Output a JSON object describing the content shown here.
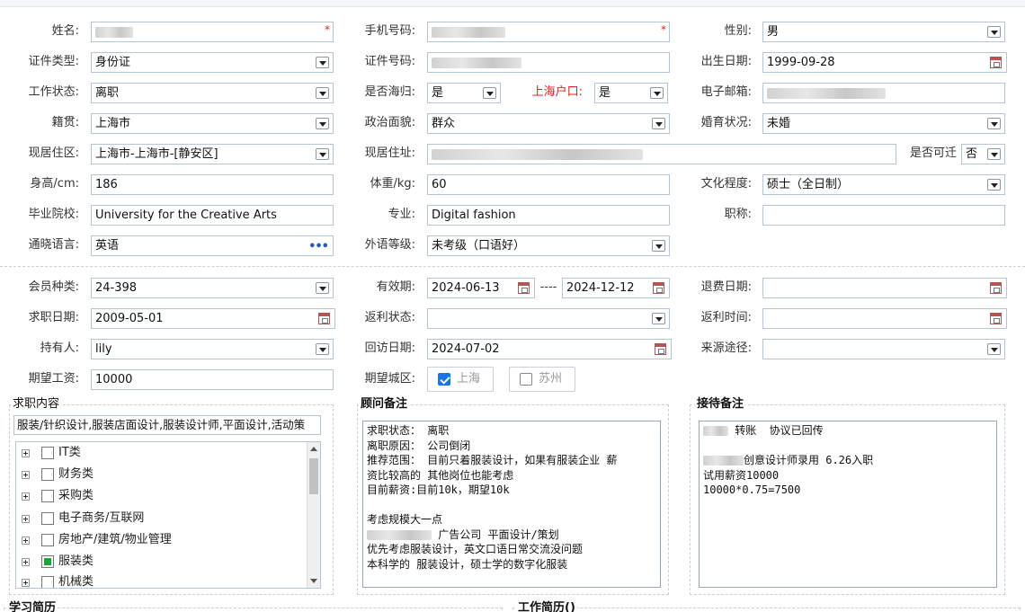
{
  "row1": {
    "name_label": "姓名:",
    "phone_label": "手机号码:",
    "gender_label": "性别:",
    "gender_value": "男",
    "required_mark": "*"
  },
  "row2": {
    "idtype_label": "证件类型:",
    "idtype_value": "身份证",
    "idno_label": "证件号码:",
    "birth_label": "出生日期:",
    "birth_value": "1999-09-28"
  },
  "row3": {
    "work_label": "工作状态:",
    "work_value": "离职",
    "returnee_label": "是否海归:",
    "returnee_value": "是",
    "hukou_label": "上海户口:",
    "hukou_value": "是",
    "email_label": "电子邮箱:"
  },
  "row4": {
    "native_label": "籍贯:",
    "native_value": "上海市",
    "political_label": "政治面貌:",
    "political_value": "群众",
    "marital_label": "婚育状况:",
    "marital_value": "未婚"
  },
  "row5": {
    "residence_label": "现居住区:",
    "residence_value": "上海市-上海市-[静安区]",
    "address_label": "现居住址:",
    "rent_label": "是否可迁",
    "rent_value": "否"
  },
  "row6": {
    "height_label": "身高/cm:",
    "height_value": "186",
    "weight_label": "体重/kg:",
    "weight_value": "60",
    "edu_label": "文化程度:",
    "edu_value": "硕士（全日制）"
  },
  "row7": {
    "school_label": "毕业院校:",
    "school_value": "University for the Creative Arts",
    "major_label": "专业:",
    "major_value": "Digital fashion",
    "title_label": "职称:"
  },
  "row8": {
    "lang_label": "通晓语言:",
    "lang_value": "英语",
    "lang_more": "•••",
    "level_label": "外语等级:",
    "level_value": "未考级（口语好）"
  },
  "row9": {
    "member_label": "会员种类:",
    "member_value": "24-398",
    "valid_label": "有效期:",
    "valid_from": "2024-06-13",
    "valid_sep": "----",
    "valid_to": "2024-12-12",
    "refund_label": "退费日期:"
  },
  "row10": {
    "apply_label": "求职日期:",
    "apply_value": "2009-05-01",
    "rebate_label": "返利状态:",
    "rebate_time_label": "返利时间:"
  },
  "row11": {
    "holder_label": "持有人:",
    "holder_value": "lily",
    "visit_label": "回访日期:",
    "visit_value": "2024-07-02",
    "source_label": "来源途径:"
  },
  "row12": {
    "salary_label": "期望工资:",
    "salary_value": "10000",
    "city_label": "期望城区:",
    "city_options": [
      {
        "label": "上海",
        "checked": true
      },
      {
        "label": "苏州",
        "checked": false
      }
    ]
  },
  "job": {
    "title": "求职内容",
    "summary": "服装/针织设计,服装店面设计,服装设计师,平面设计,活动策",
    "categories": [
      {
        "label": "IT类",
        "checked": false
      },
      {
        "label": "财务类",
        "checked": false
      },
      {
        "label": "采购类",
        "checked": false
      },
      {
        "label": "电子商务/互联网",
        "checked": false
      },
      {
        "label": "房地产/建筑/物业管理",
        "checked": false
      },
      {
        "label": "服装类",
        "checked": true
      },
      {
        "label": "机械类",
        "checked": false
      }
    ]
  },
  "advisor": {
    "title": "顾问备注",
    "lines": [
      "求职状态： 离职",
      "离职原因： 公司倒闭",
      "推荐范围： 目前只着服装设计，如果有服装企业 薪",
      "资比较高的 其他岗位也能考虑",
      "目前薪资:目前10k，期望10k",
      "",
      "考虑规模大一点",
      "广告公司 平面设计/策划",
      "优先考虑服装设计，英文口语日常交流没问题",
      "本科学的 服装设计，硕士学的数字化服装"
    ]
  },
  "reception": {
    "title": "接待备注",
    "lines": [
      "转账  协议已回传",
      "",
      "创意设计师录用 6.26入职",
      "试用薪资10000",
      "10000*0.75=7500"
    ]
  },
  "bottom": {
    "study_title": "学习简历",
    "work_title": "工作简历()"
  }
}
